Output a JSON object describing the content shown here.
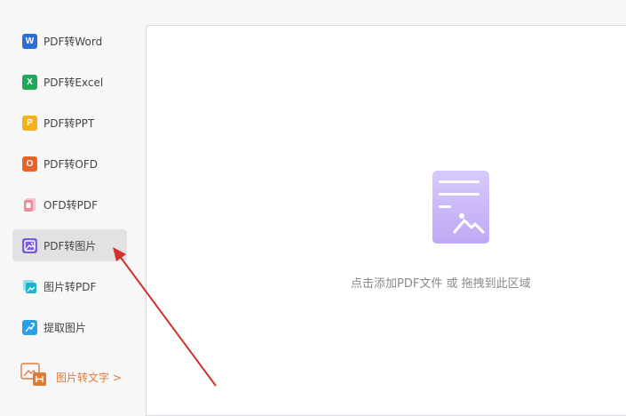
{
  "sidebar": {
    "items": [
      {
        "label": "PDF转Word",
        "icon": "word-icon",
        "glyph": "W",
        "color": "#2b6fd6"
      },
      {
        "label": "PDF转Excel",
        "icon": "excel-icon",
        "glyph": "X",
        "color": "#1fa85a"
      },
      {
        "label": "PDF转PPT",
        "icon": "ppt-icon",
        "glyph": "P",
        "color": "#f2b21c"
      },
      {
        "label": "PDF转OFD",
        "icon": "ofd-icon",
        "glyph": "O",
        "color": "#e8622a"
      },
      {
        "label": "OFD转PDF",
        "icon": "pdf-icon",
        "glyph": "",
        "color": "#ee8a9a"
      },
      {
        "label": "PDF转图片",
        "icon": "image-icon",
        "glyph": "",
        "color": "#7b5be0",
        "active": true
      },
      {
        "label": "图片转PDF",
        "icon": "image-to-pdf-icon",
        "glyph": "",
        "color": "#1bb3c9"
      },
      {
        "label": "提取图片",
        "icon": "extract-image-icon",
        "glyph": "",
        "color": "#2aa0e8"
      }
    ],
    "promo": {
      "label": "图片转文字 >",
      "icon": "ocr-icon",
      "color": "#e07a3a"
    }
  },
  "main": {
    "drop_hint": "点击添加PDF文件 或 拖拽到此区域",
    "illustration": "document-image-icon",
    "illustration_color": "#c9b8f7"
  },
  "annotation": {
    "color": "#d0322b"
  }
}
